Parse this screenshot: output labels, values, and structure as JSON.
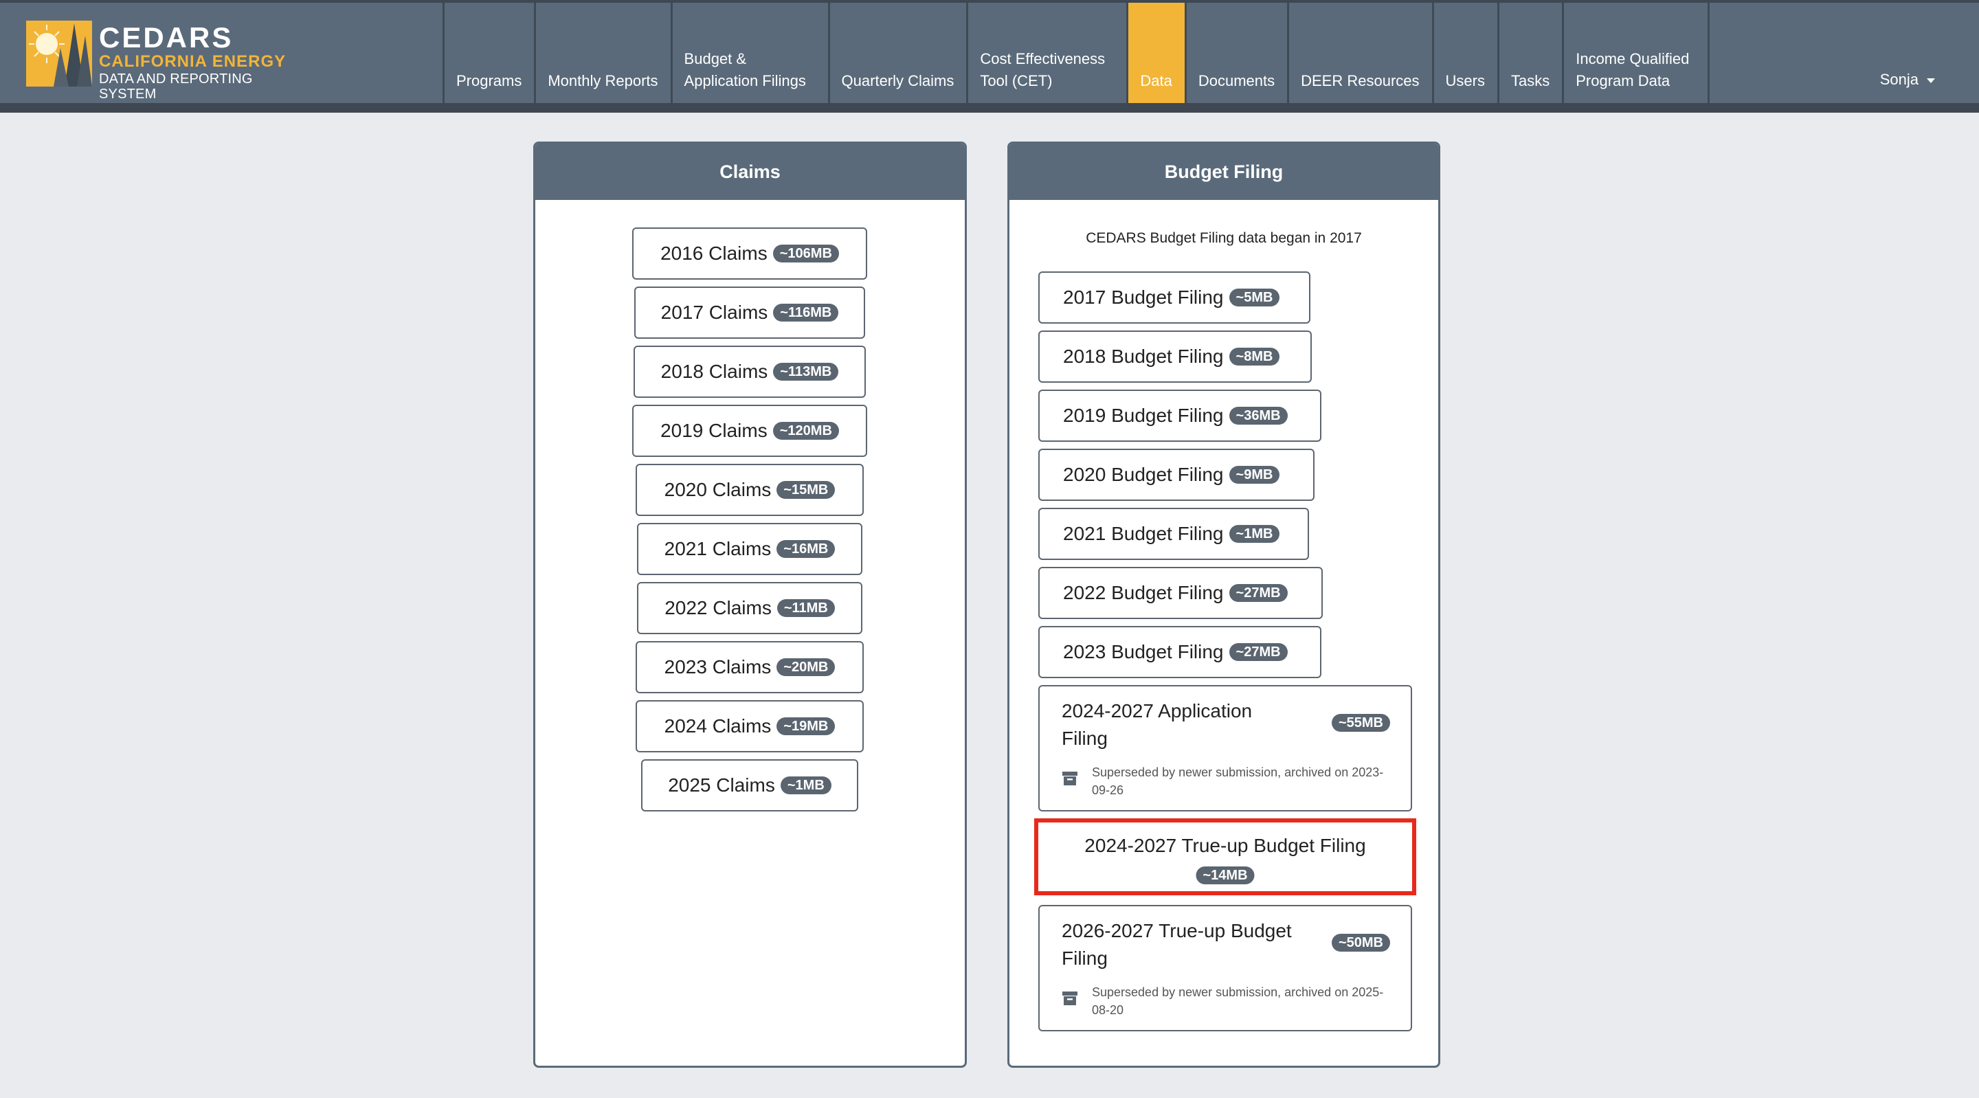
{
  "brand": {
    "title": "CEDARS",
    "subtitle1": "CALIFORNIA ENERGY",
    "subtitle2": "DATA AND REPORTING SYSTEM",
    "logo_icon": "redwood-sun-logo-icon"
  },
  "nav": {
    "items": [
      {
        "label": "Programs"
      },
      {
        "label": "Monthly Reports"
      },
      {
        "label": "Budget & Application Filings"
      },
      {
        "label": "Quarterly Claims"
      },
      {
        "label": "Cost Effectiveness Tool (CET)"
      },
      {
        "label": "Data",
        "active": true
      },
      {
        "label": "Documents"
      },
      {
        "label": "DEER Resources"
      },
      {
        "label": "Users"
      },
      {
        "label": "Tasks"
      },
      {
        "label": "Income Qualified Program Data"
      }
    ],
    "user": "Sonja"
  },
  "claims": {
    "header": "Claims",
    "items": [
      {
        "label": "2016 Claims",
        "size": "~106MB"
      },
      {
        "label": "2017 Claims",
        "size": "~116MB"
      },
      {
        "label": "2018 Claims",
        "size": "~113MB"
      },
      {
        "label": "2019 Claims",
        "size": "~120MB"
      },
      {
        "label": "2020 Claims",
        "size": "~15MB"
      },
      {
        "label": "2021 Claims",
        "size": "~16MB"
      },
      {
        "label": "2022 Claims",
        "size": "~11MB"
      },
      {
        "label": "2023 Claims",
        "size": "~20MB"
      },
      {
        "label": "2024 Claims",
        "size": "~19MB"
      },
      {
        "label": "2025 Claims",
        "size": "~1MB"
      }
    ]
  },
  "budget": {
    "header": "Budget Filing",
    "intro": "CEDARS Budget Filing data began in 2017",
    "items": [
      {
        "label": "2017 Budget Filing",
        "size": "~5MB"
      },
      {
        "label": "2018 Budget Filing",
        "size": "~8MB"
      },
      {
        "label": "2019 Budget Filing",
        "size": "~36MB"
      },
      {
        "label": "2020 Budget Filing",
        "size": "~9MB"
      },
      {
        "label": "2021 Budget Filing",
        "size": "~1MB"
      },
      {
        "label": "2022 Budget Filing",
        "size": "~27MB"
      },
      {
        "label": "2023 Budget Filing",
        "size": "~27MB"
      }
    ],
    "application": {
      "label": "2024-2027 Application Filing",
      "size": "~55MB",
      "note": "Superseded by newer submission, archived on 2023-09-26"
    },
    "trueup_2024": {
      "label": "2024-2027 True-up Budget Filing",
      "size": "~14MB"
    },
    "trueup_2026": {
      "label": "2026-2027 True-up Budget Filing",
      "size": "~50MB",
      "note": "Superseded by newer submission, archived on 2025-08-20"
    }
  },
  "colors": {
    "navbar": "#5a6a7a",
    "active_nav": "#f2b538",
    "highlight": "#e8291b",
    "badge": "#5a6570"
  }
}
